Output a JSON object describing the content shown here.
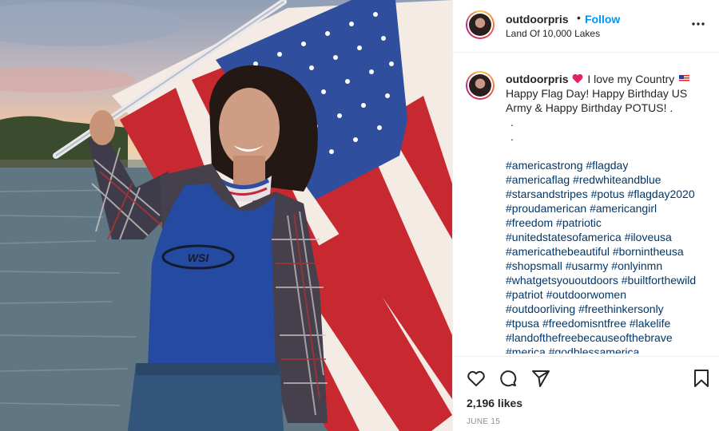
{
  "post": {
    "username": "outdoorpris",
    "separator": "•",
    "follow_label": "Follow",
    "location": "Land Of 10,000 Lakes",
    "shirt_logo_text": "WSI",
    "caption": {
      "username": "outdoorpris",
      "line_text_1": "I love my Country",
      "line_text_2": "Happy Flag Day! Happy Birthday US Army & Happy Birthday POTUS! .",
      "dot_lines": [
        ".",
        "."
      ],
      "hashtag_lines": [
        [
          "#americastrong",
          "#flagday"
        ],
        [
          "#americaflag",
          "#redwhiteandblue"
        ],
        [
          "#starsandstripes",
          "#potus",
          "#flagday2020"
        ],
        [
          "#proudamerican",
          "#americangirl"
        ],
        [
          "#freedom",
          "#patriotic"
        ],
        [
          "#unitedstatesofamerica",
          "#iloveusa"
        ],
        [
          "#americathebeautiful",
          "#bornintheusa"
        ],
        [
          "#shopsmall",
          "#usarmy",
          "#onlyinmn"
        ],
        [
          "#whatgetsyououtdoors",
          "#builtforthewild"
        ],
        [
          "#patriot",
          "#outdoorwomen"
        ],
        [
          "#outdoorliving",
          "#freethinkersonly"
        ],
        [
          "#tpusa",
          "#freedomisntfree",
          "#lakelife"
        ],
        [
          "#landofthefreebecauseofthebrave"
        ],
        [
          "#merica",
          "#godblessamerica"
        ]
      ]
    },
    "likes": "2,196 likes",
    "date": "JUNE 15"
  },
  "icons": {
    "more": "more-options-icon",
    "like": "heart-outline-icon",
    "comment": "comment-bubble-icon",
    "share": "paper-plane-icon",
    "save": "bookmark-icon",
    "caption_heart": "red-heart-emoji",
    "caption_flag": "us-flag-emoji"
  },
  "colors": {
    "link_blue": "#0095f6",
    "hashtag": "#00376b",
    "text": "#262626",
    "muted": "#8e8e8e",
    "border": "#efefef"
  }
}
